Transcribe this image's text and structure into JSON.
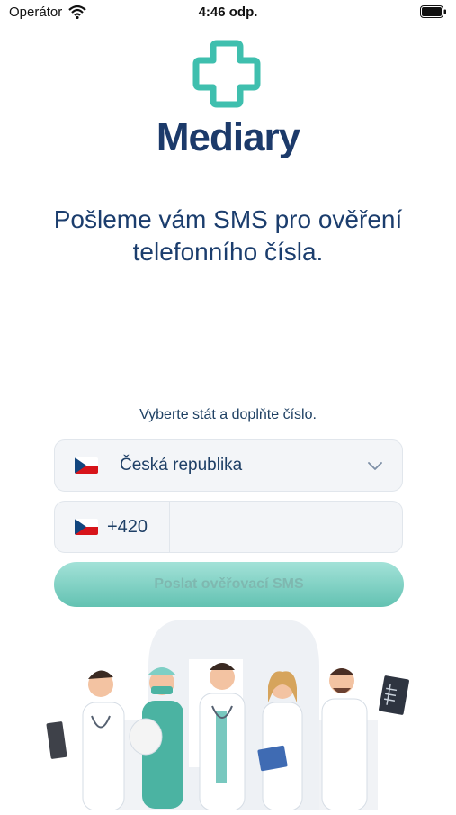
{
  "status_bar": {
    "carrier": "Operátor",
    "time": "4:46 odp."
  },
  "brand": {
    "name": "Mediary",
    "color": "#1c3a6a",
    "accent": "#3fbfae"
  },
  "headline": "Pošleme vám SMS pro ověření telefonního čísla.",
  "form": {
    "hint": "Vyberte stát a doplňte číslo.",
    "country": {
      "selected": "Česká republika",
      "flag": "cz-flag-icon"
    },
    "phone": {
      "prefix": "+420",
      "value": "",
      "placeholder": ""
    },
    "send_button": "Poslat ověřovací SMS"
  },
  "illustration": {
    "subject": "five-doctors-illustration"
  }
}
